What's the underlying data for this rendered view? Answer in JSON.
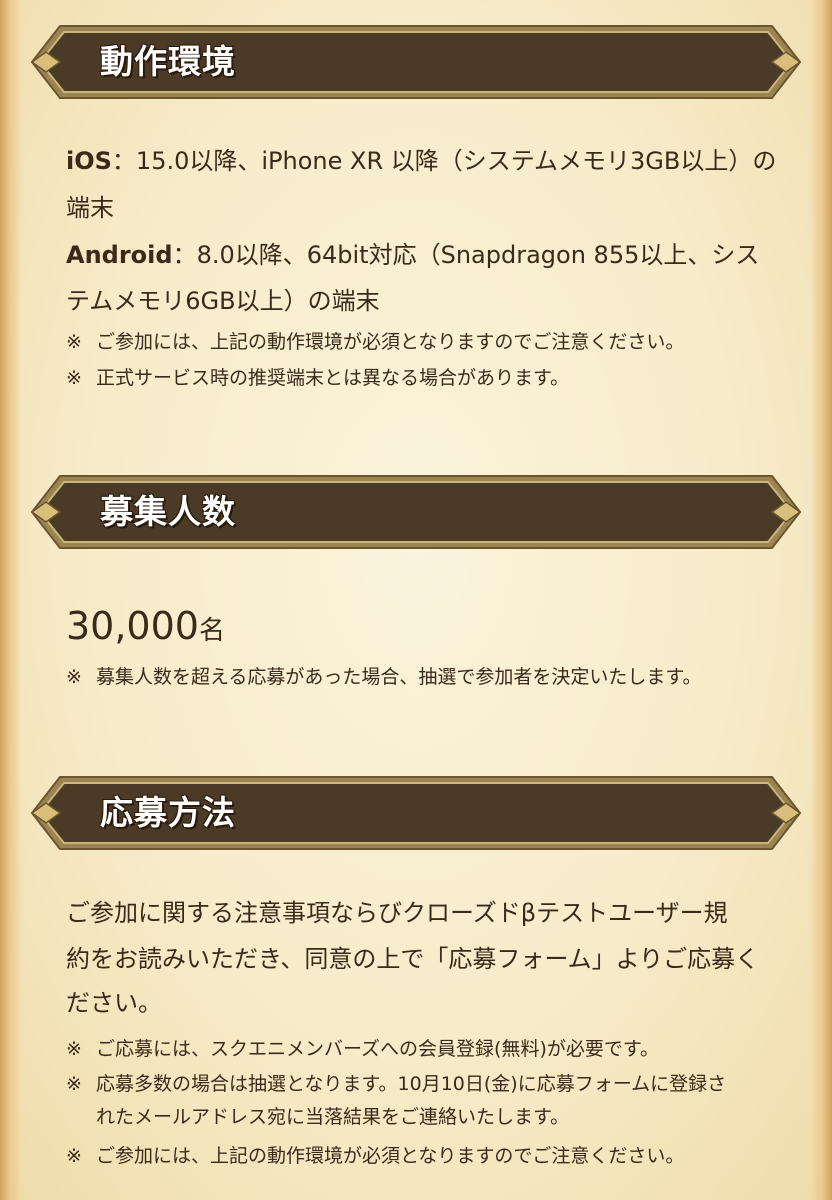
{
  "sections": {
    "environment": {
      "title": "動作環境",
      "ios_label": "iOS",
      "ios_rest": "：15.0以降、iPhone XR 以降（システムメモリ3GB以上）の",
      "ios_line2": "端末",
      "android_label": "Android",
      "android_rest": "：8.0以降、64bit対応（Snapdragon 855以上、シス",
      "android_line2": "テムメモリ6GB以上）の端末",
      "notes": [
        "ご参加には、上記の動作環境が必須となりますのでご注意ください。",
        "正式サービス時の推奨端末とは異なる場合があります。"
      ]
    },
    "recruitment": {
      "title": "募集人数",
      "count": "30,000",
      "unit": "名",
      "notes": [
        "募集人数を超える応募があった場合、抽選で参加者を決定いたします。"
      ]
    },
    "apply": {
      "title": "応募方法",
      "lines": [
        "ご参加に関する注意事項ならびクローズドβテストユーザー規",
        "約をお読みいただき、同意の上で「応募フォーム」よりご応募く",
        "ださい。"
      ],
      "notes": [
        "ご応募には、スクエニメンバーズへの会員登録(無料)が必要です。",
        "応募多数の場合は抽選となります。10月10日(金)に応募フォームに登録さ",
        "れたメールアドレス宛に当落結果をご連絡いたします。",
        "ご参加には、上記の動作環境が必須となりますのでご注意ください。"
      ]
    }
  },
  "note_mark": "※",
  "colors": {
    "banner_fill": "#4a3a26",
    "banner_border": "#b9a66a",
    "banner_text": "#ffffff",
    "body_text": "#3b2a1a",
    "parchment": "#f7ebc9"
  }
}
